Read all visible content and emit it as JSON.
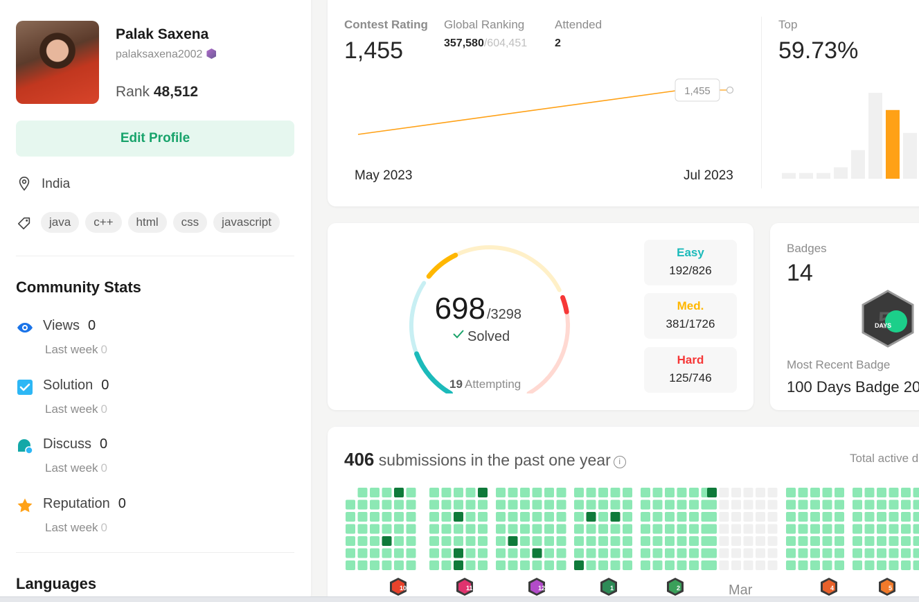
{
  "profile": {
    "name": "Palak Saxena",
    "username": "palaksaxena2002",
    "rank_label": "Rank",
    "rank_value": "48,512",
    "edit_button": "Edit Profile",
    "location": "India",
    "skills": [
      "java",
      "c++",
      "html",
      "css",
      "javascript"
    ]
  },
  "community_stats": {
    "title": "Community Stats",
    "items": [
      {
        "label": "Views",
        "value": "0",
        "sub_label": "Last week",
        "sub_value": "0",
        "icon": "eye-icon"
      },
      {
        "label": "Solution",
        "value": "0",
        "sub_label": "Last week",
        "sub_value": "0",
        "icon": "solution-check-icon"
      },
      {
        "label": "Discuss",
        "value": "0",
        "sub_label": "Last week",
        "sub_value": "0",
        "icon": "discuss-bubble-icon"
      },
      {
        "label": "Reputation",
        "value": "0",
        "sub_label": "Last week",
        "sub_value": "0",
        "icon": "star-icon"
      }
    ]
  },
  "languages": {
    "title": "Languages"
  },
  "contest": {
    "rating_label": "Contest Rating",
    "rating_value": "1,455",
    "global_label": "Global Ranking",
    "global_rank": "357,580",
    "global_total": "/604,451",
    "attended_label": "Attended",
    "attended_value": "2",
    "top_label": "Top",
    "top_value": "59.73%",
    "tooltip_value": "1,455",
    "x_start": "May 2023",
    "x_end": "Jul 2023"
  },
  "chart_data": [
    {
      "type": "line",
      "x": [
        "May 2023",
        "Jul 2023"
      ],
      "series": [
        {
          "values": [
            1400,
            1455
          ]
        }
      ],
      "annotations": [
        "1,455"
      ]
    },
    {
      "type": "bar",
      "values": [
        1,
        1,
        1,
        2,
        5,
        15,
        12,
        8
      ],
      "highlight_index": 6
    }
  ],
  "solved": {
    "solved_count": "698",
    "total": "/3298",
    "solved_label": "Solved",
    "attempting_count": "19",
    "attempting_label": "Attempting",
    "easy_fraction": 0.2324,
    "medium_fraction": 0.2207,
    "hard_fraction": 0.1676,
    "difficulties": [
      {
        "name": "Easy",
        "value": "192/826",
        "color": "#1cbaba"
      },
      {
        "name": "Med.",
        "value": "381/1726",
        "color": "#ffb700"
      },
      {
        "name": "Hard",
        "value": "125/746",
        "color": "#f63737"
      }
    ]
  },
  "badges": {
    "label": "Badges",
    "count": "14",
    "badge_text": "DAYS",
    "recent_label": "Most Recent Badge",
    "recent_name": "100 Days Badge 20"
  },
  "submissions": {
    "count": "406",
    "text": "submissions in the past one year",
    "total_active_label": "Total active d",
    "month_label": "Mar",
    "monthly_badges": [
      "10",
      "11",
      "12",
      "1",
      "2",
      "",
      "4",
      "5"
    ]
  },
  "colors": {
    "accent_green": "#18a36b",
    "orange": "#ffa116",
    "heat_light": "#8ce8b4",
    "heat_dark": "#0f7a3a"
  }
}
